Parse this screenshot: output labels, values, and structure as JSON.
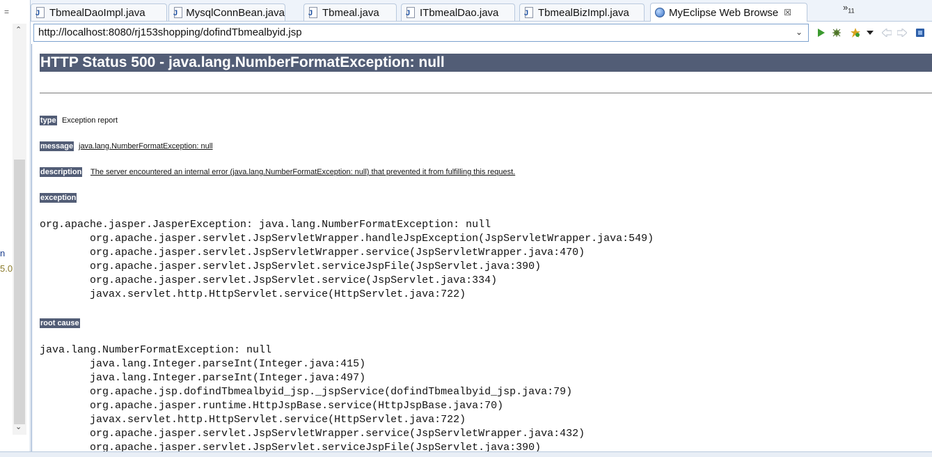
{
  "tabs": [
    {
      "label": "TbmealDaoImpl.java",
      "icon": "java-file-icon"
    },
    {
      "label": "MysqlConnBean.java",
      "icon": "java-file-icon"
    },
    {
      "label": "Tbmeal.java",
      "icon": "java-file-icon"
    },
    {
      "label": "ITbmealDao.java",
      "icon": "java-file-icon"
    },
    {
      "label": "TbmealBizImpl.java",
      "icon": "java-file-icon"
    },
    {
      "label": "MyEclipse Web Browse",
      "icon": "globe-icon",
      "close": "☒"
    }
  ],
  "tab_overflow": {
    "chevron": "»",
    "count": "11"
  },
  "gutter": {
    "frag1": "n",
    "frag2": "5.0",
    "top": "="
  },
  "browser": {
    "url": "http://localhost:8080/rj153shopping/dofindTbmealbyid.jsp"
  },
  "page": {
    "title": "HTTP Status 500 - java.lang.NumberFormatException: null",
    "type_label": "type",
    "type_value": "Exception report",
    "message_label": "message",
    "message_value": "java.lang.NumberFormatException: null",
    "description_label": "description",
    "description_value": "The server encountered an internal error (java.lang.NumberFormatException: null) that prevented it from fulfilling this request.",
    "exception_label": "exception",
    "exception_trace": "org.apache.jasper.JasperException: java.lang.NumberFormatException: null\n\torg.apache.jasper.servlet.JspServletWrapper.handleJspException(JspServletWrapper.java:549)\n\torg.apache.jasper.servlet.JspServletWrapper.service(JspServletWrapper.java:470)\n\torg.apache.jasper.servlet.JspServlet.serviceJspFile(JspServlet.java:390)\n\torg.apache.jasper.servlet.JspServlet.service(JspServlet.java:334)\n\tjavax.servlet.http.HttpServlet.service(HttpServlet.java:722)",
    "root_cause_label": "root cause",
    "root_cause_trace": "java.lang.NumberFormatException: null\n\tjava.lang.Integer.parseInt(Integer.java:415)\n\tjava.lang.Integer.parseInt(Integer.java:497)\n\torg.apache.jsp.dofindTbmealbyid_jsp._jspService(dofindTbmealbyid_jsp.java:79)\n\torg.apache.jasper.runtime.HttpJspBase.service(HttpJspBase.java:70)\n\tjavax.servlet.http.HttpServlet.service(HttpServlet.java:722)\n\torg.apache.jasper.servlet.JspServletWrapper.service(JspServletWrapper.java:432)\n\torg.apache.jasper.servlet.JspServlet.serviceJspFile(JspServlet.java:390)"
  },
  "colors": {
    "heading_bg": "#525d76",
    "tab_border": "#b9c9de",
    "url_border": "#7da2ce"
  }
}
